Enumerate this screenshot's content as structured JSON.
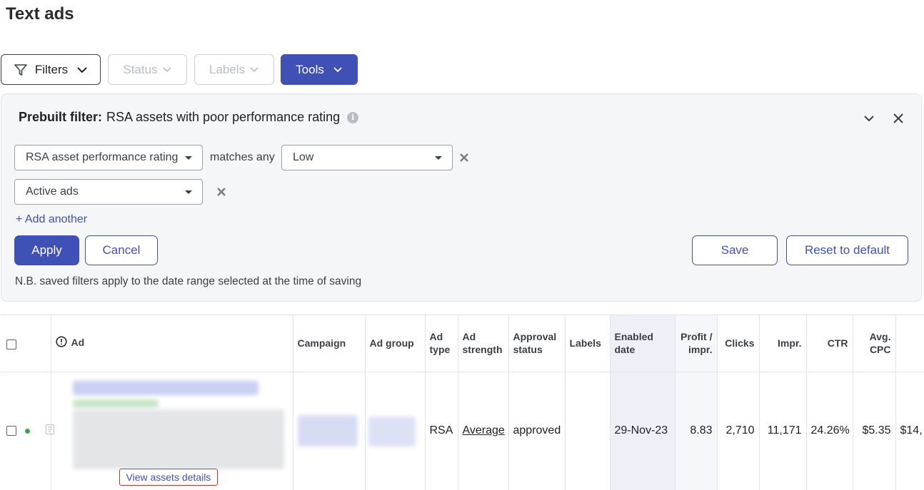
{
  "page": {
    "title": "Text ads"
  },
  "toolbar": {
    "filters_label": "Filters",
    "status_label": "Status",
    "labels_label": "Labels",
    "tools_label": "Tools"
  },
  "filter_panel": {
    "heading_bold": "Prebuilt filter:",
    "heading_text": "RSA assets with poor performance rating",
    "rule1": {
      "field": "RSA asset performance rating",
      "operator": "matches any",
      "value": "Low"
    },
    "rule2": {
      "field": "Active ads"
    },
    "add_another": "+ Add another",
    "apply_label": "Apply",
    "cancel_label": "Cancel",
    "save_label": "Save",
    "reset_label": "Reset to default",
    "note": "N.B. saved filters apply to the date range selected at the time of saving"
  },
  "table": {
    "headers": {
      "ad": "Ad",
      "campaign": "Campaign",
      "ad_group": "Ad group",
      "ad_type": "Ad type",
      "ad_strength": "Ad strength",
      "approval_status": "Approval status",
      "labels": "Labels",
      "enabled_date": "Enabled date",
      "profit_impr": "Profit / impr.",
      "clicks": "Clicks",
      "impr": "Impr.",
      "ctr": "CTR",
      "avg_cpc": "Avg. CPC",
      "cost": ""
    },
    "row": {
      "view_assets": "View assets details",
      "ad_type": "RSA",
      "ad_strength": "Average",
      "approval_status": "approved",
      "labels": "",
      "enabled_date": "29-Nov-23",
      "profit_impr": "8.83",
      "clicks": "2,710",
      "impr": "11,171",
      "ctr": "24.26%",
      "avg_cpc": "$5.35",
      "cost": "$14,"
    }
  },
  "colors": {
    "accent": "#3f51b5",
    "status_active": "#34a853",
    "highlight_border": "#d93025"
  }
}
